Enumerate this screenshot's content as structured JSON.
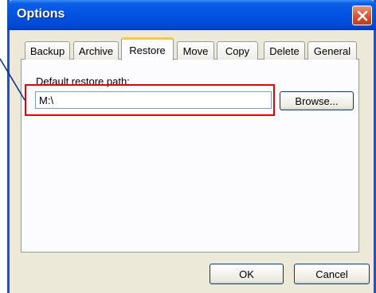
{
  "window": {
    "title": "Options"
  },
  "tabs": [
    {
      "label": "Backup"
    },
    {
      "label": "Archive"
    },
    {
      "label": "Restore"
    },
    {
      "label": "Move"
    },
    {
      "label": "Copy"
    },
    {
      "label": "Delete"
    },
    {
      "label": "General"
    }
  ],
  "active_tab": "Restore",
  "restore": {
    "label": "Default restore path:",
    "path_value": "M:\\",
    "browse_label": "Browse..."
  },
  "footer": {
    "ok_label": "OK",
    "cancel_label": "Cancel"
  },
  "colors": {
    "annotation": "#e00000",
    "title_bar": "#0253e0",
    "active_tab_accent": "#ffc83c"
  }
}
